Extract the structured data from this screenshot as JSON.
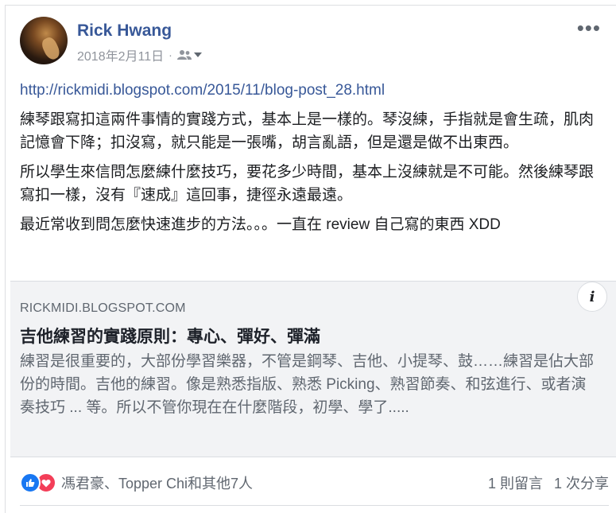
{
  "post": {
    "author": "Rick Hwang",
    "date": "2018年2月11日",
    "separator": "·",
    "audience_icon": "friends-icon",
    "more_icon": "more-horizontal-icon",
    "more_label": "•••",
    "link_url": "http://rickmidi.blogspot.com/2015/11/blog-post_28.html",
    "paragraphs": [
      "練琴跟寫扣這兩件事情的實踐方式，基本上是一樣的。琴沒練，手指就是會生疏，肌肉記憶會下降；扣沒寫，就只能是一張嘴，胡言亂語，但是還是做不出東西。",
      "所以學生來信問怎麼練什麼技巧，要花多少時間，基本上沒練就是不可能。然後練琴跟寫扣一樣，沒有『速成』這回事，捷徑永遠最遠。",
      "最近常收到問怎麼快速進步的方法。。。一直在 review 自己寫的東西 XDD"
    ]
  },
  "link_preview": {
    "domain": "RICKMIDI.BLOGSPOT.COM",
    "title": "吉他練習的實踐原則：專心、彈好、彈滿",
    "description": "練習是很重要的，大部份學習樂器，不管是鋼琴、吉他、小提琴、鼓……練習是佔大部份的時間。吉他的練習。像是熟悉指版、熟悉 Picking、熟習節奏、和弦進行、或者演奏技巧 ... 等。所以不管你現在在什麼階段，初學、學了.....",
    "info_label": "i"
  },
  "footer": {
    "reaction_icons": [
      "like-icon",
      "love-icon"
    ],
    "reactors": "馮君豪、Topper Chi和其他7人",
    "comments": "1 則留言",
    "shares": "1 次分享"
  },
  "colors": {
    "link": "#385898",
    "like": "#1877f2",
    "love": "#f33e58",
    "preview_bg": "#f2f3f5",
    "muted": "#606770"
  }
}
